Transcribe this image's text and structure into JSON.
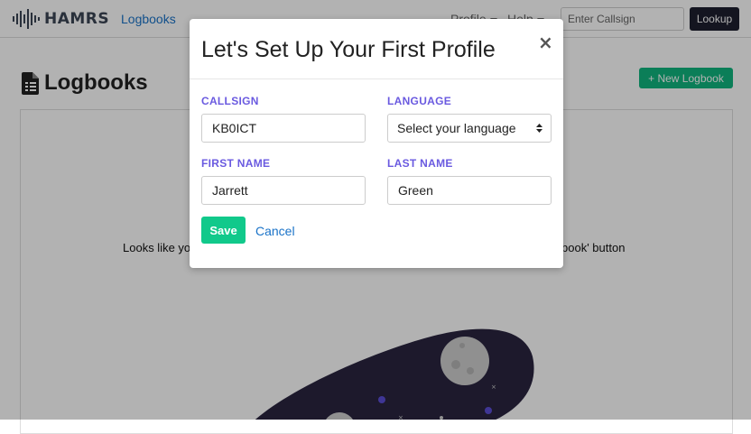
{
  "app": {
    "logo_text": "HAMRS",
    "nav": {
      "logbooks": "Logbooks",
      "profile": "Profile",
      "help": "Help"
    },
    "search": {
      "placeholder": "Enter Callsign",
      "value": ""
    },
    "lookup_label": "Lookup"
  },
  "page": {
    "title": "Logbooks",
    "new_logbook_label": "+ New Logbook",
    "empty_text_left": "Looks like yo",
    "empty_text_right": "book' button"
  },
  "modal": {
    "title": "Let's Set Up Your First Profile",
    "close_label": "×",
    "fields": {
      "callsign": {
        "label": "CALLSIGN",
        "value": "KB0ICT"
      },
      "language": {
        "label": "LANGUAGE",
        "value": "Select your language"
      },
      "first_name": {
        "label": "FIRST NAME",
        "value": "Jarrett"
      },
      "last_name": {
        "label": "LAST NAME",
        "value": "Green"
      }
    },
    "save_label": "Save",
    "cancel_label": "Cancel"
  },
  "colors": {
    "primary_green": "#11c98b",
    "label_purple": "#6a5ae0",
    "link_blue": "#1a73c8",
    "dark_button": "#1e1f2e",
    "illustration_navy": "#2a2540"
  }
}
